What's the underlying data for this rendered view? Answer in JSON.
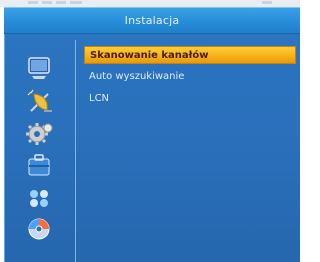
{
  "window": {
    "title": "Instalacja"
  },
  "sidebar": {
    "icons": [
      {
        "name": "tv-monitor-icon",
        "color": "#5a8fd0"
      },
      {
        "name": "satellite-dish-icon",
        "color": "#f0c040"
      },
      {
        "name": "settings-gear-icon",
        "color": "#cfcfcf"
      },
      {
        "name": "briefcase-icon",
        "color": "#3a8ad8"
      },
      {
        "name": "games-icon",
        "color": "#9ad0ff"
      },
      {
        "name": "media-disc-icon",
        "color": "#ff6a3a"
      }
    ]
  },
  "menu": {
    "items": [
      {
        "label": "Skanowanie kanałów",
        "selected": true
      },
      {
        "label": "Auto wyszukiwanie",
        "selected": false
      },
      {
        "label": "LCN",
        "selected": false
      }
    ]
  },
  "theme": {
    "accent": "#f5b11a",
    "panel": "#2a6fba",
    "title_bar": "#2a90da"
  }
}
